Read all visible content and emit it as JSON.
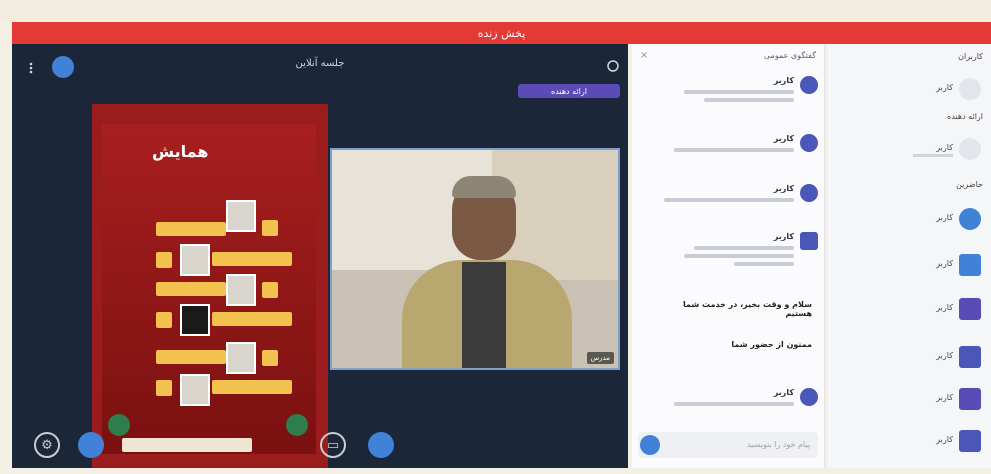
{
  "redbar": {
    "title": "پخش زنده"
  },
  "stage": {
    "title": "جلسه آنلاین",
    "presenter_tag": "ارائه دهنده",
    "poster": {
      "headline": "همایش"
    },
    "video": {
      "caption": "مدرس"
    }
  },
  "chat": {
    "header": "گفتگوی عمومی",
    "messages": [
      {
        "name": "کاربر"
      },
      {
        "name": "کاربر"
      },
      {
        "name": "کاربر"
      },
      {
        "name": "کاربر"
      },
      {
        "bold": "سلام و وقت بخیر، در خدمت شما هستیم"
      },
      {
        "bold": "ممنون از حضور شما"
      },
      {
        "name": "کاربر"
      }
    ],
    "input_placeholder": "پیام خود را بنویسید"
  },
  "people": {
    "header": "کاربران",
    "sections": [
      "ارائه دهنده",
      "حاضرین"
    ],
    "items": [
      {
        "name": "کاربر"
      },
      {
        "name": "کاربر"
      },
      {
        "name": "کاربر"
      },
      {
        "name": "کاربر"
      },
      {
        "name": "کاربر"
      },
      {
        "name": "کاربر"
      },
      {
        "name": "کاربر"
      },
      {
        "name": "کاربر"
      }
    ]
  },
  "colors": {
    "accent": "#e53935",
    "stage_bg": "#1b2738",
    "button_blue": "#3f82d8",
    "avatar_purple": "#4a56b8"
  }
}
